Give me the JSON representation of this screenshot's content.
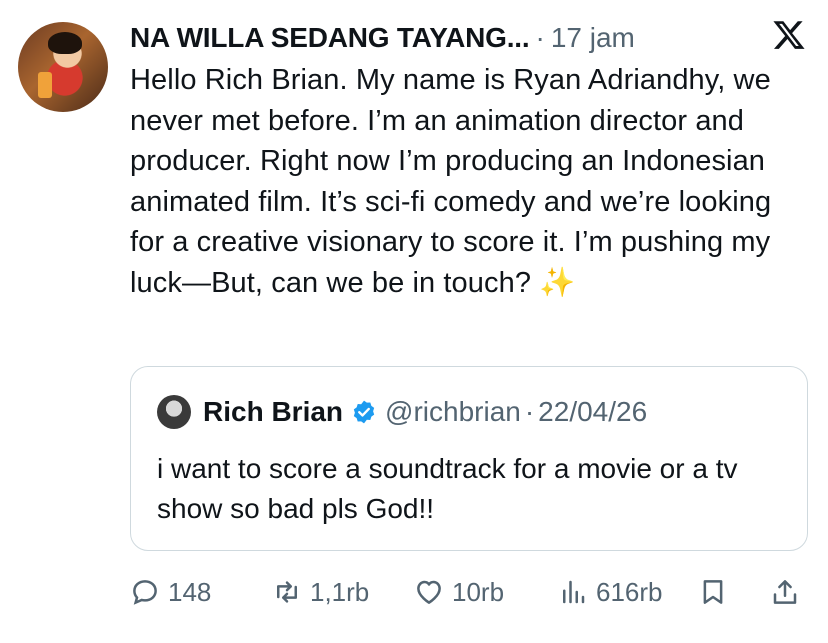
{
  "tweet": {
    "author_name": "NA WILLA SEDANG TAYANG...",
    "separator": "·",
    "time": "17 jam",
    "text": "Hello Rich Brian. My name is Ryan Adriandhy, we never met before. I’m an animation director and producer. Right now I’m producing an Indonesian animated film. It’s sci-fi comedy and we’re looking for a creative visionary to score it. I’m pushing my luck—But, can we be in touch?",
    "emoji": "✨"
  },
  "quote": {
    "name": "Rich Brian",
    "handle": "@richbrian",
    "separator": "·",
    "date": "22/04/26",
    "text": "i want to score a soundtrack for a movie or a tv show so bad pls God!!"
  },
  "actions": {
    "replies": "148",
    "reposts": "1,1rb",
    "likes": "10rb",
    "views": "616rb"
  },
  "icons": {
    "platform": "x-logo-icon",
    "verified": "verified-badge-icon",
    "reply": "reply-icon",
    "repost": "repost-icon",
    "like": "heart-icon",
    "views": "views-icon",
    "bookmark": "bookmark-icon",
    "share": "share-icon"
  },
  "colors": {
    "text": "#0f1419",
    "secondary": "#536471",
    "verified": "#1d9bf0",
    "border": "#cfd9de"
  }
}
